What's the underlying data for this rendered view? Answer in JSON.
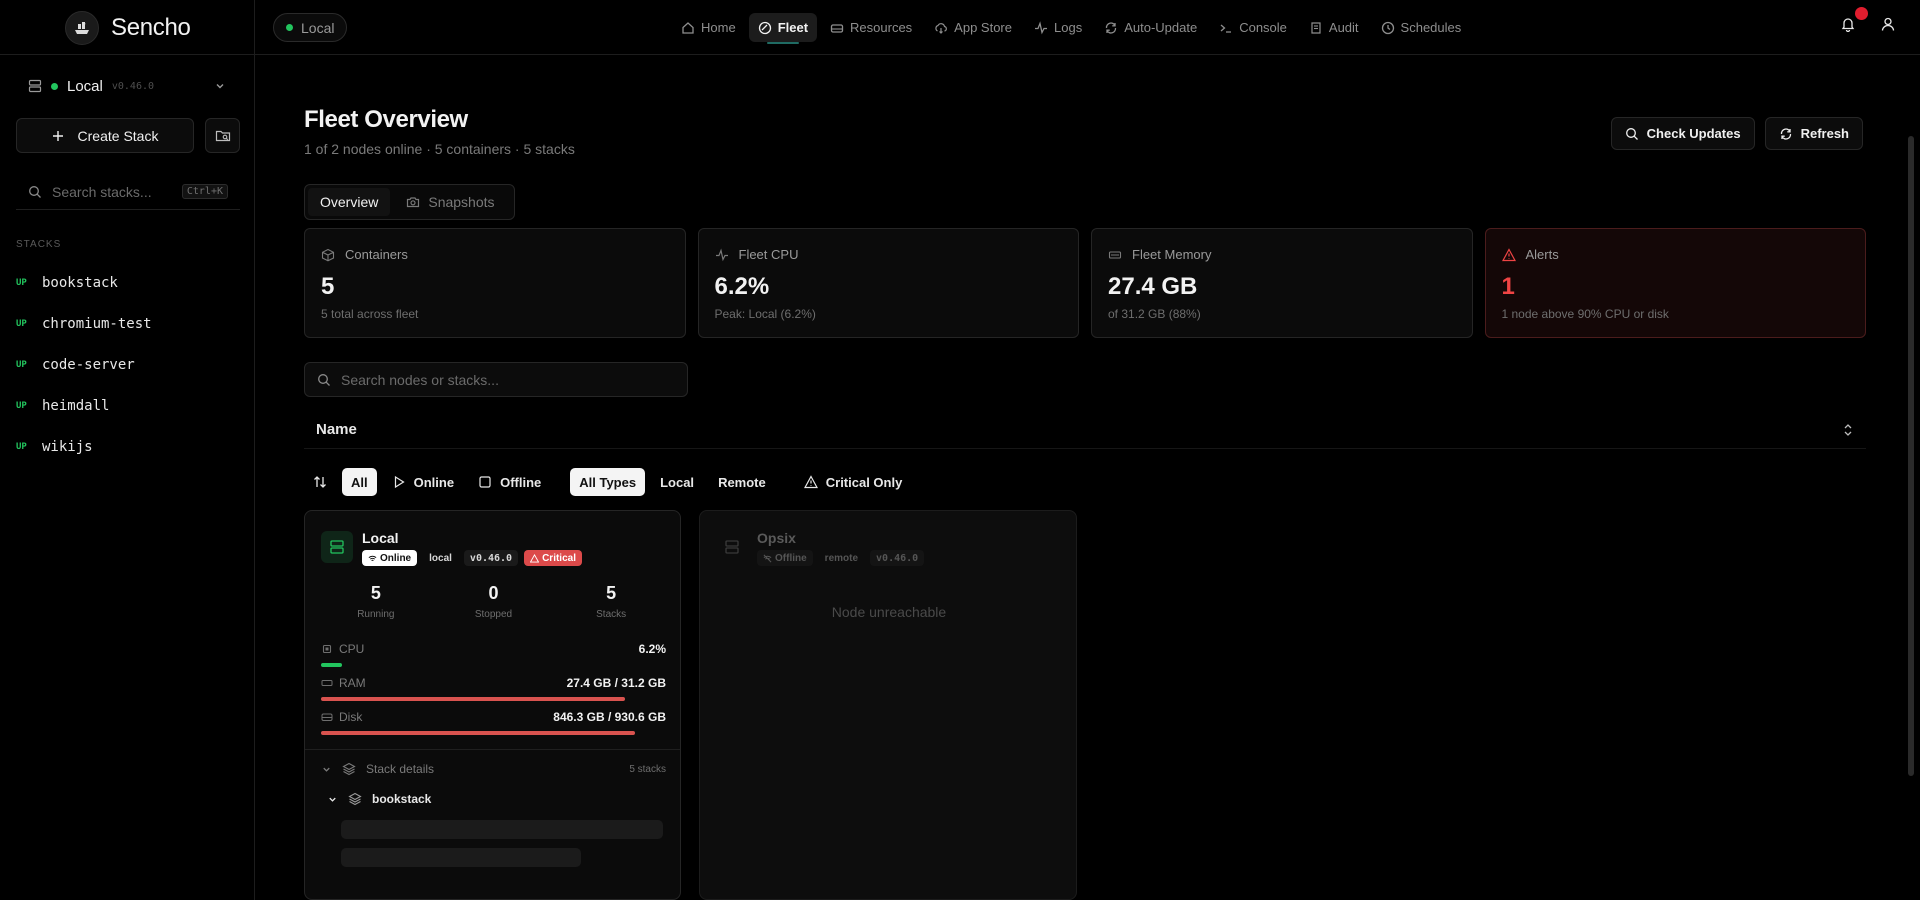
{
  "app": {
    "name": "Sencho",
    "node_pill": "Local"
  },
  "nav": [
    {
      "label": "Home",
      "icon": "home-icon"
    },
    {
      "label": "Fleet",
      "icon": "fleet-icon",
      "active": true
    },
    {
      "label": "Resources",
      "icon": "drive-icon"
    },
    {
      "label": "App Store",
      "icon": "cloud-download-icon"
    },
    {
      "label": "Logs",
      "icon": "activity-icon"
    },
    {
      "label": "Auto-Update",
      "icon": "refresh-icon"
    },
    {
      "label": "Console",
      "icon": "terminal-icon"
    },
    {
      "label": "Audit",
      "icon": "scroll-icon"
    },
    {
      "label": "Schedules",
      "icon": "clock-icon"
    }
  ],
  "sidebar": {
    "node": {
      "name": "Local",
      "version": "v0.46.0"
    },
    "create_label": "Create Stack",
    "search_placeholder": "Search stacks...",
    "search_shortcut": "Ctrl+K",
    "stacks_heading": "STACKS",
    "stacks": [
      {
        "status": "UP",
        "name": "bookstack"
      },
      {
        "status": "UP",
        "name": "chromium-test"
      },
      {
        "status": "UP",
        "name": "code-server"
      },
      {
        "status": "UP",
        "name": "heimdall"
      },
      {
        "status": "UP",
        "name": "wikijs"
      }
    ]
  },
  "page": {
    "title": "Fleet Overview",
    "subtitle": "1 of 2 nodes online · 5 containers · 5 stacks",
    "check_updates_label": "Check Updates",
    "refresh_label": "Refresh",
    "tabs": [
      {
        "label": "Overview",
        "active": true
      },
      {
        "label": "Snapshots"
      }
    ]
  },
  "stats": {
    "containers": {
      "label": "Containers",
      "value": "5",
      "sub": "5 total across fleet"
    },
    "cpu": {
      "label": "Fleet CPU",
      "value": "6.2%",
      "sub": "Peak: Local (6.2%)"
    },
    "memory": {
      "label": "Fleet Memory",
      "value": "27.4 GB",
      "sub": "of 31.2 GB (88%)"
    },
    "alerts": {
      "label": "Alerts",
      "value": "1",
      "sub": "1 node above 90% CPU or disk"
    }
  },
  "filters": {
    "search_placeholder": "Search nodes or stacks...",
    "sort_by": "Name",
    "status": [
      "All",
      "Online",
      "Offline"
    ],
    "types": [
      "All Types",
      "Local",
      "Remote"
    ],
    "critical_label": "Critical Only"
  },
  "nodes": {
    "local": {
      "name": "Local",
      "status": "Online",
      "type": "local",
      "version": "v0.46.0",
      "health": "Critical",
      "running": "5",
      "running_label": "Running",
      "stopped": "0",
      "stopped_label": "Stopped",
      "stacks": "5",
      "stacks_label": "Stacks",
      "cpu_label": "CPU",
      "cpu_value": "6.2%",
      "cpu_fraction": 0.062,
      "ram_label": "RAM",
      "ram_value": "27.4 GB / 31.2 GB",
      "ram_fraction": 0.88,
      "disk_label": "Disk",
      "disk_value": "846.3 GB / 930.6 GB",
      "disk_fraction": 0.91,
      "stack_details_label": "Stack details",
      "stack_details_count": "5 stacks",
      "expanded_stack": "bookstack"
    },
    "opsix": {
      "name": "Opsix",
      "status": "Offline",
      "type": "remote",
      "version": "v0.46.0",
      "message": "Node unreachable"
    }
  },
  "colors": {
    "green": "#22c55e",
    "danger": "#dc4a4a",
    "bar_red": "#d9534f"
  }
}
